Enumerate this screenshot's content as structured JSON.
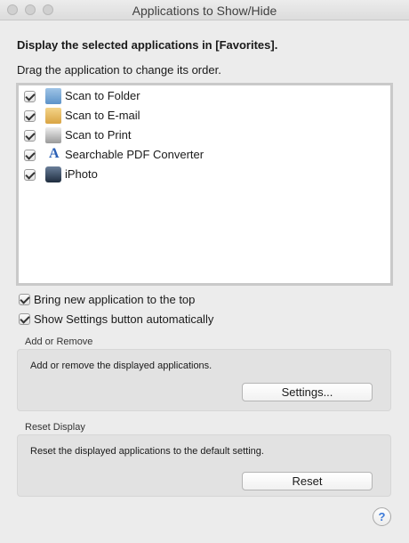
{
  "window": {
    "title": "Applications to Show/Hide"
  },
  "main": {
    "heading": "Display the selected applications in [Favorites].",
    "instruction": "Drag the application to change its order."
  },
  "apps": [
    {
      "label": "Scan to Folder",
      "checked": true,
      "icon": "folder-icon"
    },
    {
      "label": "Scan to E-mail",
      "checked": true,
      "icon": "email-icon"
    },
    {
      "label": "Scan to Print",
      "checked": true,
      "icon": "printer-icon"
    },
    {
      "label": "Searchable PDF Converter",
      "checked": true,
      "icon": "pdf-converter-icon"
    },
    {
      "label": "iPhoto",
      "checked": true,
      "icon": "iphoto-icon"
    }
  ],
  "options": {
    "bring_to_top": {
      "label": "Bring new application to the top",
      "checked": true
    },
    "show_settings": {
      "label": "Show Settings button automatically",
      "checked": true
    }
  },
  "add_remove": {
    "title": "Add or Remove",
    "description": "Add or remove the displayed applications.",
    "button_label": "Settings..."
  },
  "reset_display": {
    "title": "Reset Display",
    "description": "Reset the displayed applications to the default setting.",
    "button_label": "Reset"
  },
  "help": {
    "label": "?"
  }
}
